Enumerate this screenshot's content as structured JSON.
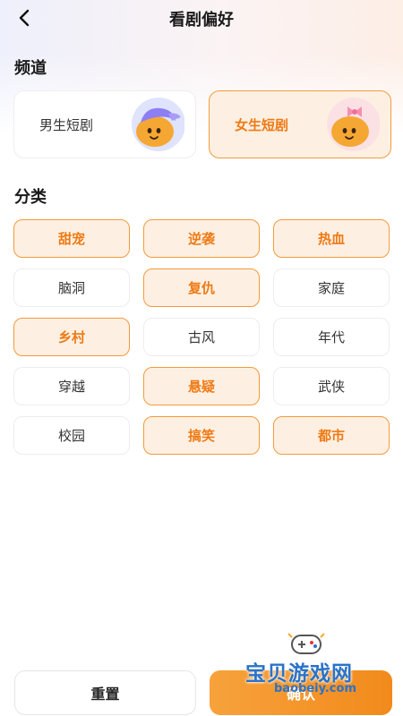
{
  "header": {
    "title": "看剧偏好",
    "back_icon": "chevron-left-icon"
  },
  "channel": {
    "title": "频道",
    "items": [
      {
        "label": "男生短剧",
        "selected": false,
        "avatar": "boy-avatar-icon"
      },
      {
        "label": "女生短剧",
        "selected": true,
        "avatar": "girl-avatar-icon"
      }
    ]
  },
  "category": {
    "title": "分类",
    "items": [
      {
        "label": "甜宠",
        "selected": true
      },
      {
        "label": "逆袭",
        "selected": true
      },
      {
        "label": "热血",
        "selected": true
      },
      {
        "label": "脑洞",
        "selected": false
      },
      {
        "label": "复仇",
        "selected": true
      },
      {
        "label": "家庭",
        "selected": false
      },
      {
        "label": "乡村",
        "selected": true
      },
      {
        "label": "古风",
        "selected": false
      },
      {
        "label": "年代",
        "selected": false
      },
      {
        "label": "穿越",
        "selected": false
      },
      {
        "label": "悬疑",
        "selected": true
      },
      {
        "label": "武侠",
        "selected": false
      },
      {
        "label": "校园",
        "selected": false
      },
      {
        "label": "搞笑",
        "selected": true
      },
      {
        "label": "都市",
        "selected": true
      }
    ]
  },
  "footer": {
    "reset_label": "重置",
    "confirm_label": "确认"
  },
  "watermark": {
    "text": "宝贝游戏网",
    "url": "baobeiy.com"
  },
  "colors": {
    "accent": "#f28a1c",
    "accent_text": "#ef7a14",
    "selected_bg": "#fdf0e3",
    "selected_border": "#f39a3a"
  }
}
